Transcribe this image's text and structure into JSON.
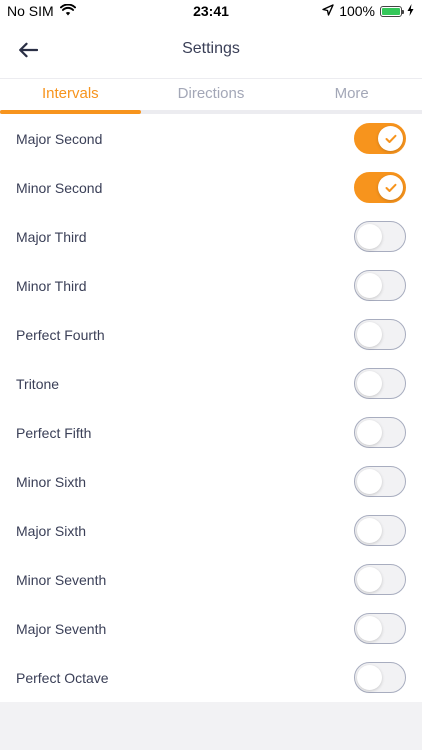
{
  "status_bar": {
    "carrier": "No SIM",
    "time": "23:41",
    "battery": "100%",
    "battery_level": 1.0,
    "icons": [
      "wifi-icon",
      "location-arrow-icon",
      "battery-icon",
      "charging-bolt-icon"
    ]
  },
  "nav": {
    "title": "Settings",
    "back_icon": "arrow-left-icon"
  },
  "tabs": [
    {
      "label": "Intervals",
      "active": true
    },
    {
      "label": "Directions",
      "active": false
    },
    {
      "label": "More",
      "active": false
    }
  ],
  "intervals": [
    {
      "label": "Major Second",
      "enabled": true
    },
    {
      "label": "Minor Second",
      "enabled": true
    },
    {
      "label": "Major Third",
      "enabled": false
    },
    {
      "label": "Minor Third",
      "enabled": false
    },
    {
      "label": "Perfect Fourth",
      "enabled": false
    },
    {
      "label": "Tritone",
      "enabled": false
    },
    {
      "label": "Perfect Fifth",
      "enabled": false
    },
    {
      "label": "Minor Sixth",
      "enabled": false
    },
    {
      "label": "Major Sixth",
      "enabled": false
    },
    {
      "label": "Minor Seventh",
      "enabled": false
    },
    {
      "label": "Major Seventh",
      "enabled": false
    },
    {
      "label": "Perfect Octave",
      "enabled": false
    }
  ],
  "colors": {
    "accent": "#f7941d",
    "text": "#3a3f57",
    "inactive_tab": "#a3a7b7",
    "toggle_off_border": "#a8adbf",
    "background": "#f2f2f4"
  }
}
